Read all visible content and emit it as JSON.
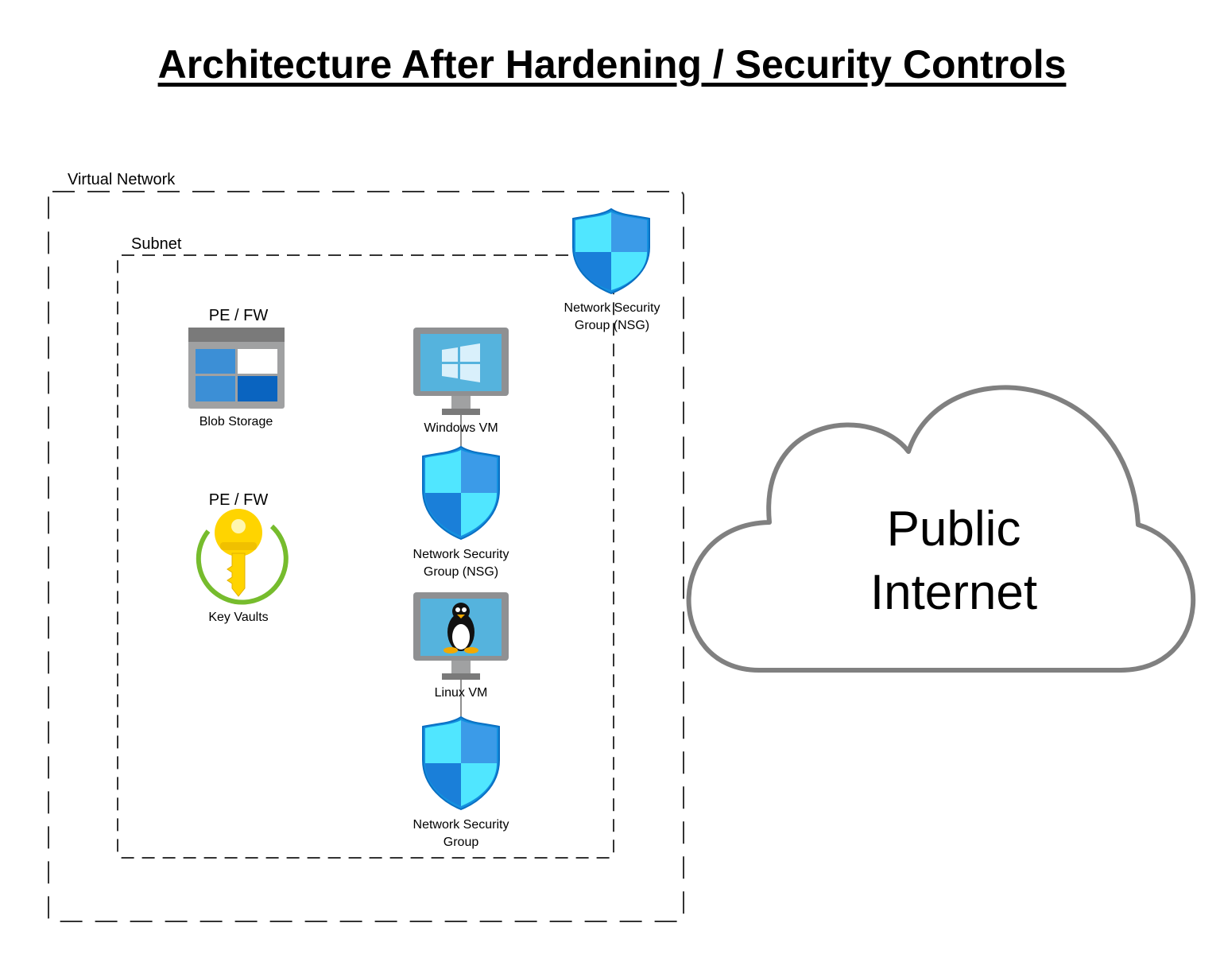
{
  "title": "Architecture After Hardening / Security Controls",
  "virtual_network": {
    "label": "Virtual Network"
  },
  "subnet": {
    "label": "Subnet"
  },
  "nodes": {
    "nsg_vnet": {
      "label_line1": "Network Security",
      "label_line2": "Group (NSG)",
      "icon": "shield-icon"
    },
    "blob_storage": {
      "tag": "PE / FW",
      "label": "Blob Storage",
      "icon": "storage-grid-icon"
    },
    "key_vaults": {
      "tag": "PE / FW",
      "label": "Key Vaults",
      "icon": "key-icon"
    },
    "windows_vm": {
      "label": "Windows VM",
      "icon": "windows-monitor-icon"
    },
    "nsg_windows": {
      "label_line1": "Network Security",
      "label_line2": "Group (NSG)",
      "icon": "shield-icon"
    },
    "linux_vm": {
      "label": "Linux VM",
      "icon": "linux-monitor-icon"
    },
    "nsg_linux": {
      "label_line1": "Network Security",
      "label_line2": "Group",
      "icon": "shield-icon"
    }
  },
  "cloud": {
    "line1": "Public",
    "line2": "Internet",
    "icon": "cloud-icon"
  },
  "colors": {
    "shield_light": "#50e6ff",
    "shield_dark": "#1490df",
    "storage_blue": "#0072c6",
    "key_gold": "#ffd400",
    "key_ring_green": "#76bc2d",
    "monitor_screen": "#55b3dd",
    "cloud_outline": "#808080"
  }
}
